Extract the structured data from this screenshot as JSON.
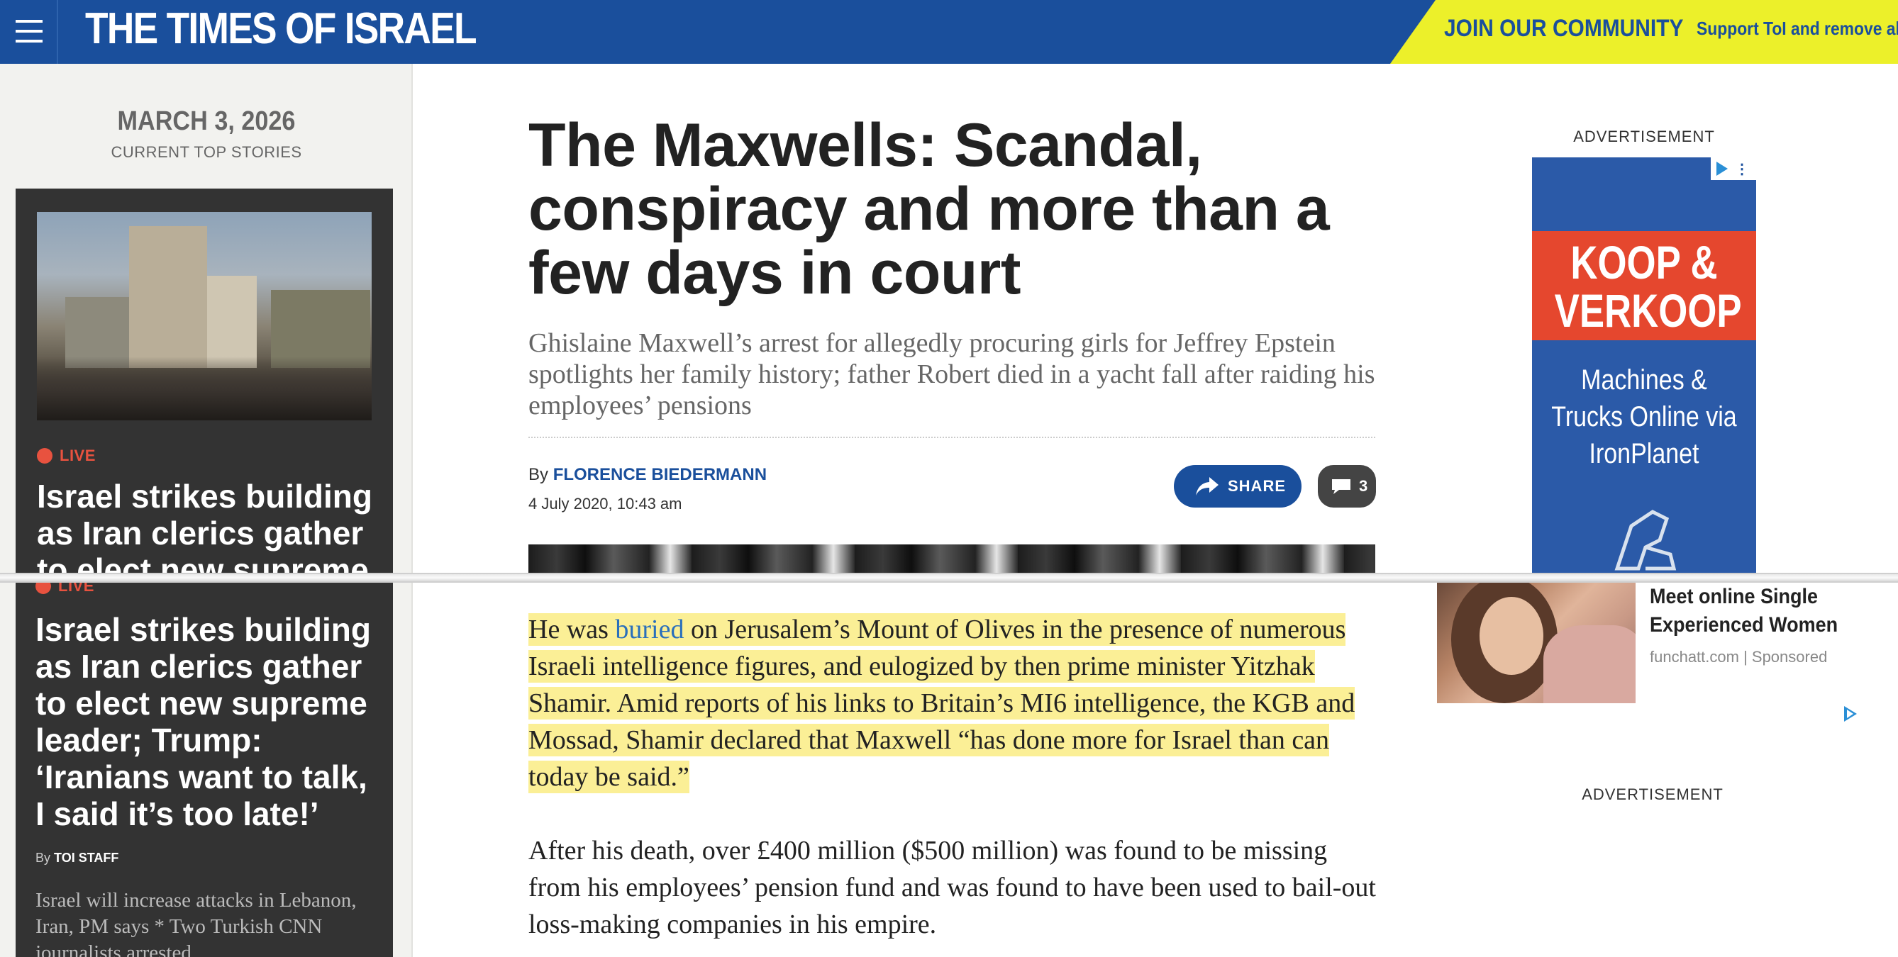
{
  "header": {
    "logo": "THE TIMES OF ISRAEL",
    "community_cta": "JOIN OUR COMMUNITY",
    "support_text": "Support ToI and remove al",
    "colors": {
      "brand_blue": "#1a4f9c",
      "cta_yellow": "#ecf02a"
    },
    "menu_icon": "hamburger-icon"
  },
  "sidebar": {
    "date": "MARCH 3, 2026",
    "date_sub": "CURRENT TOP STORIES",
    "story": {
      "live_label": "LIVE",
      "headline_top": "Israel strikes building as Iran clerics gather to elect new supreme",
      "headline": "Israel strikes building as Iran clerics gather to elect new supreme leader; Trump: ‘Iranians want to talk, I said it’s too late!’",
      "byline_prefix": "By",
      "byline_author": "TOI STAFF",
      "teaser": "Israel will increase attacks in Lebanon, Iran, PM says * Two Turkish CNN journalists arrested"
    }
  },
  "article": {
    "title": "The Maxwells: Scandal, conspiracy and more than a few days in court",
    "subtitle": "Ghislaine Maxwell’s arrest for allegedly procuring girls for Jeffrey Epstein spotlights her family history; father Robert died in a yacht fall after raiding his employees’ pensions",
    "byline_prefix": "By",
    "author": "FLORENCE BIEDERMANN",
    "published": "4 July 2020, 10:43 am",
    "share_label": "SHARE",
    "comment_count": "3",
    "para1_before": "He was ",
    "para1_link": "buried",
    "para1_after": " on Jerusalem’s Mount of Olives in the presence of numerous Israeli intelligence figures, and eulogized by then prime minister Yitzhak Shamir. Amid reports of his links to Britain’s MI6 intelligence, the KGB and Mossad, Shamir declared that Maxwell “has done more for Israel than can today be said.”",
    "para2": "After his death, over £400 million ($500 million) was found to be missing from his employees’ pension fund and was found to have been used to bail-out loss-making companies in his empire.",
    "highlight_color": "#fbef96"
  },
  "right_column": {
    "ad_label_1": "ADVERTISEMENT",
    "ad": {
      "headline_1": "KOOP &",
      "headline_2": "VERKOOP",
      "body_1": "Machines &",
      "body_2": "Trucks Online via",
      "body_3": "IronPlanet"
    },
    "sponsored": {
      "title": "Meet online Single Experienced Women",
      "source": "funchatt.com | Sponsored"
    },
    "ad_label_2": "ADVERTISEMENT"
  }
}
